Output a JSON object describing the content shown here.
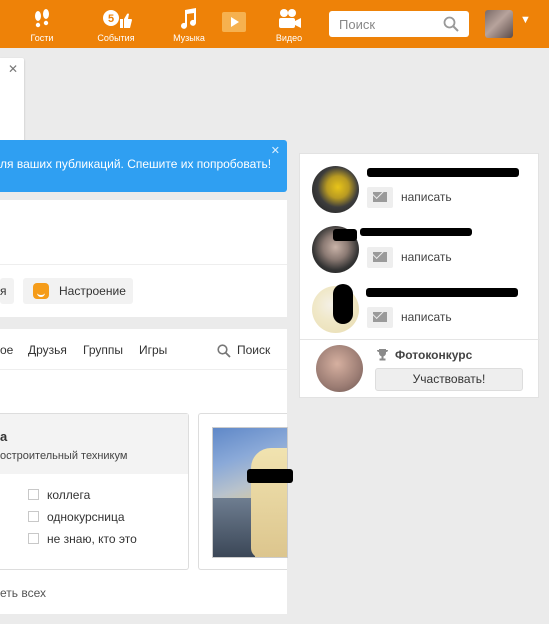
{
  "topbar": {
    "nav": [
      {
        "label": "Гости",
        "icon": "footprints-icon"
      },
      {
        "label": "События",
        "icon": "events-icon",
        "badge": "5"
      },
      {
        "label": "Музыка",
        "icon": "music-icon"
      },
      {
        "label": "Видео",
        "icon": "video-camera-icon"
      }
    ],
    "search_placeholder": "Поиск",
    "accent_color": "#ee8208"
  },
  "banner": {
    "text": "ля ваших публикаций. Спешите их попробовать!",
    "color": "#2f9ff2"
  },
  "post_box": {
    "chip_prev_label": "я",
    "mood_label": "Настроение"
  },
  "friends": {
    "tabs": [
      "ое",
      "Друзья",
      "Группы",
      "Игры"
    ],
    "search_label": "Поиск",
    "person": {
      "name": "а",
      "school": "остроительный техникум",
      "options": [
        "коллега",
        "однокурсница",
        "не знаю, кто это"
      ]
    },
    "show_all": "еть всех"
  },
  "right_panel": {
    "items": [
      {
        "message_label": "написать"
      },
      {
        "message_label": "написать"
      },
      {
        "message_label": "написать"
      }
    ],
    "contest_title": "Фотоконкурс",
    "participate_label": "Участвовать!"
  }
}
